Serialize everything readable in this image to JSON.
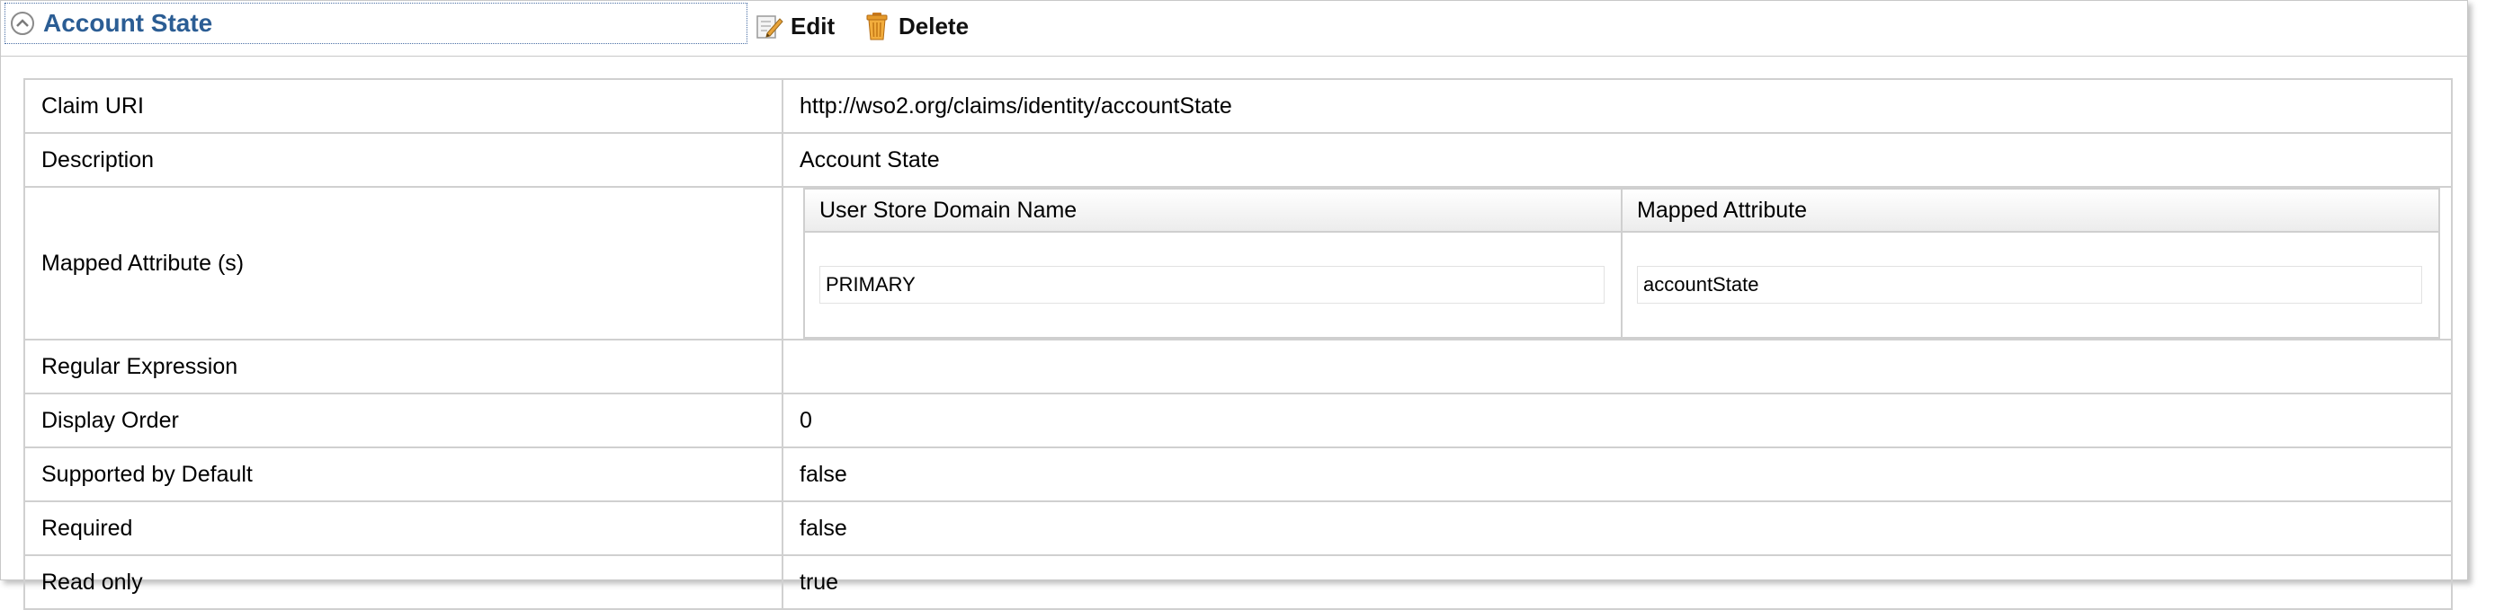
{
  "header": {
    "title": "Account State",
    "edit_label": "Edit",
    "delete_label": "Delete"
  },
  "claim": {
    "rows": [
      {
        "key": "Claim URI",
        "value": "http://wso2.org/claims/identity/accountState"
      },
      {
        "key": "Description",
        "value": "Account State"
      }
    ],
    "mapped_label": "Mapped Attribute (s)",
    "mapping": {
      "col_domain": "User Store Domain Name",
      "col_attribute": "Mapped Attribute",
      "domain_value": "PRIMARY",
      "attribute_value": "accountState"
    },
    "rows_after": [
      {
        "key": "Regular Expression",
        "value": ""
      },
      {
        "key": "Display Order",
        "value": "0"
      },
      {
        "key": "Supported by Default",
        "value": "false"
      },
      {
        "key": "Required",
        "value": "false"
      },
      {
        "key": "Read only",
        "value": "true"
      }
    ]
  }
}
